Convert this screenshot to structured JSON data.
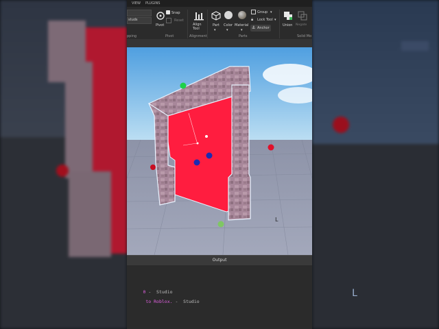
{
  "menu": {
    "view": "VIEW",
    "plugins": "PLUGINS"
  },
  "ribbon": {
    "transform_value": "studs",
    "snap_label": "Snap",
    "reset_label": "Reset",
    "pivot_label": "Pivot",
    "align_tool_label": "Align Tool",
    "part_label": "Part",
    "color_label": "Color",
    "material_label": "Material",
    "group_label": "Group",
    "lock_tool_label": "Lock Tool",
    "anchor_label": "Anchor",
    "union_label": "Union",
    "negate_label": "Negate",
    "groups": {
      "snapping": "pping",
      "pivot": "Pivot",
      "alignment": "Alignment",
      "parts": "Parts",
      "solid_modeling": "Solid Mo"
    }
  },
  "output": {
    "title": "Output",
    "line1_prefix": "0",
    "line1_suffix": " -  Studio",
    "line2_prefix": " to Roblox.",
    "line2_suffix": " -  Studio"
  },
  "colors": {
    "sky_top": "#4f9fe0",
    "sky_bottom": "#bfe0f3",
    "floor": "#9aa0b4",
    "door_red": "#ff1d3f",
    "stone": "#a8879a",
    "ui_dark": "#2e2e2e"
  },
  "icons": [
    "pivot-icon",
    "align-tool-icon",
    "part-icon",
    "color-icon",
    "material-icon",
    "group-icon",
    "lock-icon",
    "anchor-icon",
    "union-icon",
    "negate-icon"
  ]
}
